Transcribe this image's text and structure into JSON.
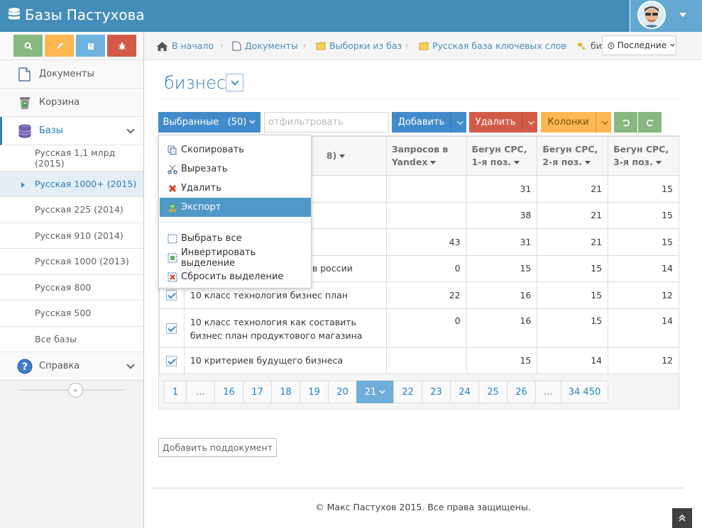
{
  "app": {
    "title": "Базы Пастухова"
  },
  "sidebar": {
    "nav": [
      {
        "label": "Документы",
        "icon": "documents-icon"
      },
      {
        "label": "Корзина",
        "icon": "recycle-bin-icon"
      },
      {
        "label": "Базы",
        "icon": "database-icon"
      }
    ],
    "sub_items": [
      "Русская 1,1 млрд (2015)",
      "Русская 1000+ (2015)",
      "Русская 225 (2014)",
      "Русская 910 (2014)",
      "Русская 1000 (2013)",
      "Русская 800",
      "Русская 500",
      "Все базы"
    ],
    "help_label": "Справка"
  },
  "breadcrumbs": {
    "home": "В начало",
    "documents": "Документы",
    "selections": "Выборки из баз",
    "russian_base": "Русская база ключевых слов",
    "current": "би",
    "recent": "Последние"
  },
  "page": {
    "title": "бизнес"
  },
  "toolbar": {
    "selected_label": "Выбранные",
    "selected_count": "(50)",
    "filter_placeholder": "отфильтровать",
    "add_label": "Добавить",
    "delete_label": "Удалить",
    "columns_label": "Колонки"
  },
  "dropdown": {
    "items": [
      "Скопировать",
      "Вырезать",
      "Удалить",
      "Экспорт",
      "Выбрать все",
      "Инвертировать выделение",
      "Сбросить выделение"
    ]
  },
  "table": {
    "headers": {
      "phrase_suffix": "8)",
      "yandex": "Запросов в Yandex",
      "cpc1": "Бегун CPC, 1-я поз.",
      "cpc2": "Бегун CPC, 2-я поз.",
      "cpc3": "Бегун CPC, 3-я поз."
    },
    "rows": [
      {
        "phrase": "",
        "yandex": "",
        "cpc1": "31",
        "cpc2": "21",
        "cpc3": "15"
      },
      {
        "phrase": "",
        "yandex": "",
        "cpc1": "38",
        "cpc2": "21",
        "cpc3": "15"
      },
      {
        "phrase": "",
        "yandex": "43",
        "cpc1": "31",
        "cpc2": "21",
        "cpc3": "15"
      },
      {
        "phrase": "в россии",
        "yandex": "0",
        "cpc1": "15",
        "cpc2": "15",
        "cpc3": "14"
      },
      {
        "phrase": "10 класс технология бизнес план",
        "yandex": "22",
        "cpc1": "16",
        "cpc2": "15",
        "cpc3": "12"
      },
      {
        "phrase": "10 класс технология как составить бизнес план продуктового магазина",
        "yandex": "0",
        "cpc1": "16",
        "cpc2": "15",
        "cpc3": "14"
      },
      {
        "phrase": "10 критериев будущего бизнеса",
        "yandex": "",
        "cpc1": "15",
        "cpc2": "14",
        "cpc3": "12"
      }
    ]
  },
  "pagination": [
    "1",
    "...",
    "16",
    "17",
    "18",
    "19",
    "20",
    "21",
    "22",
    "23",
    "24",
    "25",
    "26",
    "...",
    "34 450"
  ],
  "pagination_active": "21",
  "actions": {
    "add_subdocument": "Добавить поддокумент"
  },
  "footer": {
    "text": "© Макс Пастухов 2015. Все права защищены."
  },
  "colors": {
    "navbar": "#438eb9",
    "primary": "#428bca",
    "danger": "#d15b47",
    "warning": "#ffb752",
    "success": "#87b87f",
    "link": "#4c8fbd"
  }
}
